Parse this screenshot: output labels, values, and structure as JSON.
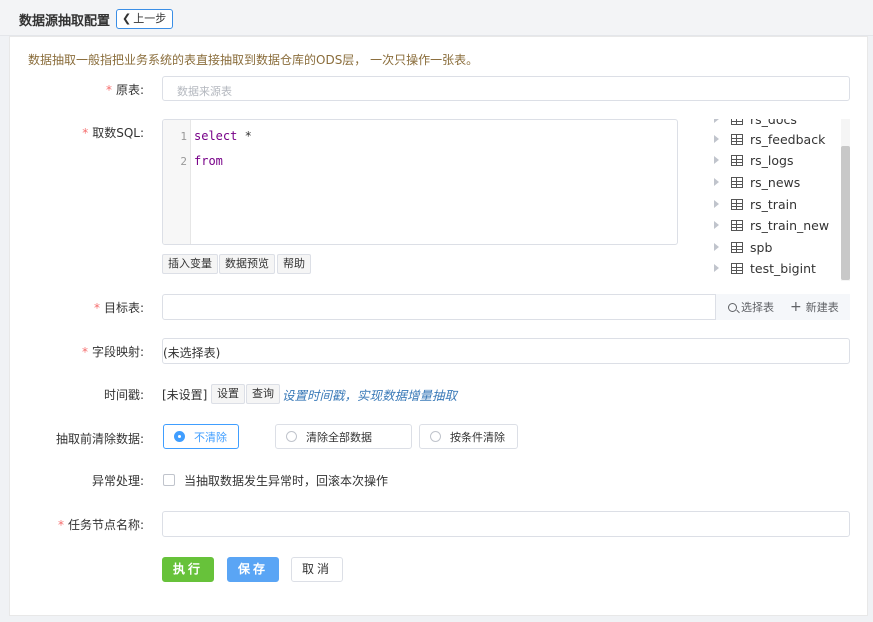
{
  "header": {
    "title": "数据源抽取配置",
    "back_label": "上一步"
  },
  "notice": "数据抽取一般指把业务系统的表直接抽取到数据仓库的ODS层， 一次只操作一张表。",
  "form": {
    "source_table": {
      "label": "原表:",
      "placeholder": "数据来源表"
    },
    "sql": {
      "label": "取数SQL:",
      "lines": [
        {
          "num": "1",
          "kw": "select",
          "rest": " *"
        },
        {
          "num": "2",
          "kw": "from",
          "rest": ""
        }
      ],
      "insert_var": "插入变量",
      "preview": "数据预览",
      "help": "帮助"
    },
    "tables": [
      "rs_docs",
      "rs_feedback",
      "rs_logs",
      "rs_news",
      "rs_train",
      "rs_train_new",
      "spb",
      "test_bigint"
    ],
    "target_table": {
      "label": "目标表:",
      "select_label": "选择表",
      "new_label": "新建表"
    },
    "field_mapping": {
      "label": "字段映射:",
      "value": "(未选择表)"
    },
    "timestamp": {
      "label": "时间戳:",
      "value": "[未设置]",
      "set_label": "设置",
      "query_label": "查询",
      "hint": "设置时间戳，实现数据增量抽取"
    },
    "pre_clear": {
      "label": "抽取前清除数据:",
      "options": [
        "不清除",
        "清除全部数据",
        "按条件清除"
      ],
      "selected": "不清除"
    },
    "exception": {
      "label": "异常处理:",
      "checkbox_label": "当抽取数据发生异常时，回滚本次操作"
    },
    "task_name": {
      "label": "任务节点名称:"
    }
  },
  "actions": {
    "run": "执行",
    "save": "保存",
    "cancel": "取消"
  }
}
